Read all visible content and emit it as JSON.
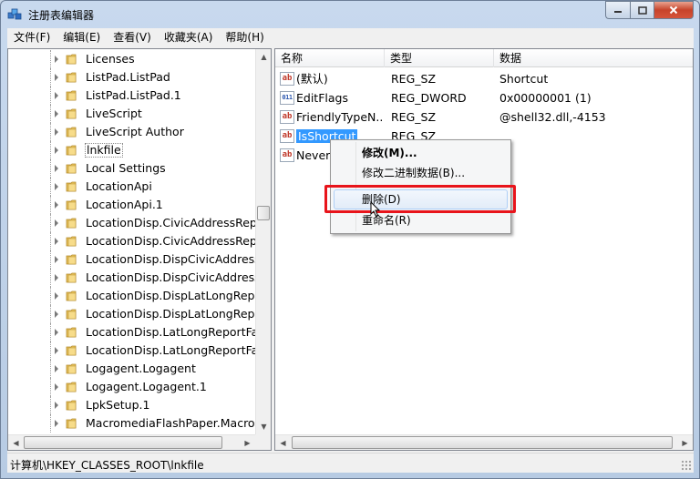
{
  "window": {
    "title": "注册表编辑器"
  },
  "menubar": [
    {
      "label": "文件(F)"
    },
    {
      "label": "编辑(E)"
    },
    {
      "label": "查看(V)"
    },
    {
      "label": "收藏夹(A)"
    },
    {
      "label": "帮助(H)"
    }
  ],
  "tree": {
    "items": [
      {
        "label": "Licenses"
      },
      {
        "label": "ListPad.ListPad"
      },
      {
        "label": "ListPad.ListPad.1"
      },
      {
        "label": "LiveScript"
      },
      {
        "label": "LiveScript Author"
      },
      {
        "label": "lnkfile",
        "selected": true
      },
      {
        "label": "Local Settings"
      },
      {
        "label": "LocationApi"
      },
      {
        "label": "LocationApi.1"
      },
      {
        "label": "LocationDisp.CivicAddressRepo"
      },
      {
        "label": "LocationDisp.CivicAddressRepo"
      },
      {
        "label": "LocationDisp.DispCivicAddressR"
      },
      {
        "label": "LocationDisp.DispCivicAddressR"
      },
      {
        "label": "LocationDisp.DispLatLongRepor"
      },
      {
        "label": "LocationDisp.DispLatLongRepor"
      },
      {
        "label": "LocationDisp.LatLongReportFac"
      },
      {
        "label": "LocationDisp.LatLongReportFac"
      },
      {
        "label": "Logagent.Logagent"
      },
      {
        "label": "Logagent.Logagent.1"
      },
      {
        "label": "LpkSetup.1"
      },
      {
        "label": "MacromediaFlashPaper.Macron"
      }
    ]
  },
  "list": {
    "columns": {
      "name": "名称",
      "type": "类型",
      "data": "数据"
    },
    "rows": [
      {
        "icon": "string-value-icon",
        "icon_text": "ab",
        "name": "(默认)",
        "type": "REG_SZ",
        "data": "Shortcut"
      },
      {
        "icon": "dword-value-icon",
        "icon_text": "011",
        "name": "EditFlags",
        "type": "REG_DWORD",
        "data": "0x00000001 (1)"
      },
      {
        "icon": "string-value-icon",
        "icon_text": "ab",
        "name": "FriendlyTypeN...",
        "type": "REG_SZ",
        "data": "@shell32.dll,-4153"
      },
      {
        "icon": "string-value-icon",
        "icon_text": "ab",
        "name": "IsShortcut",
        "type": "REG_SZ",
        "data": "",
        "selected": true
      },
      {
        "icon": "string-value-icon",
        "icon_text": "ab",
        "name": "NeverS",
        "type": "",
        "data": ""
      }
    ]
  },
  "context_menu": {
    "modify": "修改(M)...",
    "modify_binary": "修改二进制数据(B)...",
    "delete": "删除(D)",
    "rename": "重命名(R)"
  },
  "statusbar": {
    "path": "计算机\\HKEY_CLASSES_ROOT\\lnkfile"
  },
  "colors": {
    "selection": "#3399ff",
    "highlight_box": "#e8141b"
  }
}
